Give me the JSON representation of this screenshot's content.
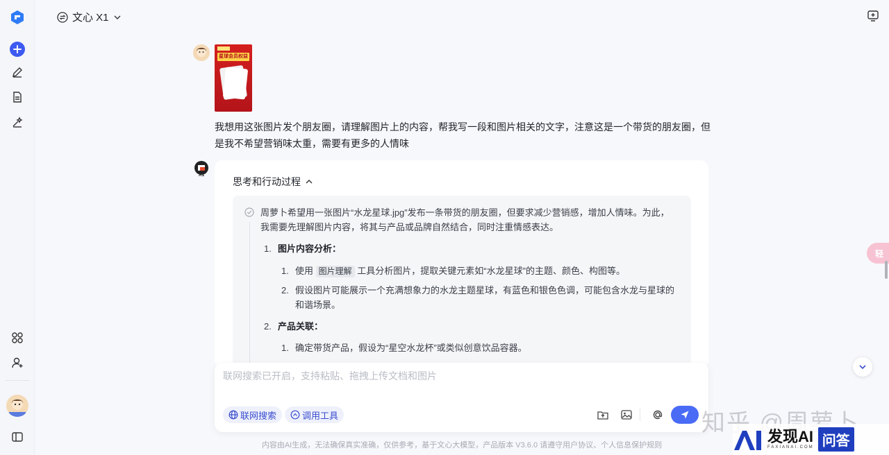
{
  "app": {
    "model_name": "文心 X1"
  },
  "conversation": {
    "user_message": "我想用这张图片发个朋友圈，请理解图片上的内容，帮我写一段和图片相关的文字，注意这是一个带货的朋友圈，但是我不希望营销味太重，需要有更多的人情味",
    "image_title": "星球会员权益",
    "ai_badge": "X1",
    "thinking_header": "思考和行动过程",
    "thinking_intro": "周萝卜希望用一张图片“水龙星球.jpg”发布一条带货的朋友圈，但要求减少营销感，增加人情味。为此，我需要先理解图片内容，将其与产品或品牌自然结合，同时注重情感表达。",
    "section1_num": "1.",
    "section1_title": "图片内容分析：",
    "s1_item1_num": "1.",
    "s1_item1_pre": "使用",
    "s1_item1_chip": "图片理解",
    "s1_item1_post": "工具分析图片，提取关键元素如“水龙星球”的主题、颜色、构图等。",
    "s1_item2_num": "2.",
    "s1_item2": "假设图片可能展示一个充满想象力的水龙主题星球，有蓝色和银色色调，可能包含水龙与星球的和谐场景。",
    "section2_num": "2.",
    "section2_title": "产品关联：",
    "s2_item1_num": "1.",
    "s2_item1": "确定带货产品，假设为“星空水龙杯”或类似创意饮品容器。"
  },
  "composer": {
    "placeholder": "联网搜索已开启，支持粘贴、拖拽上传文档和图片",
    "web_search_label": "联网搜索",
    "tools_label": "调用工具"
  },
  "footer": {
    "disclaimer": "内容由AI生成，无法确保真实准确，仅供参考，基于文心大模型，产品版本 V3.6.0 请遵守用户协议、个人信息保护规则"
  },
  "watermarks": {
    "zhihu": "知乎 @周萝卜",
    "site_name": "发现AI",
    "site_domain": "FAXIANAI.COM",
    "site_tag": "问答",
    "float_badge": "轻"
  },
  "colors": {
    "accent": "#4a6bf5",
    "brand_blue": "#3a4ccf"
  }
}
